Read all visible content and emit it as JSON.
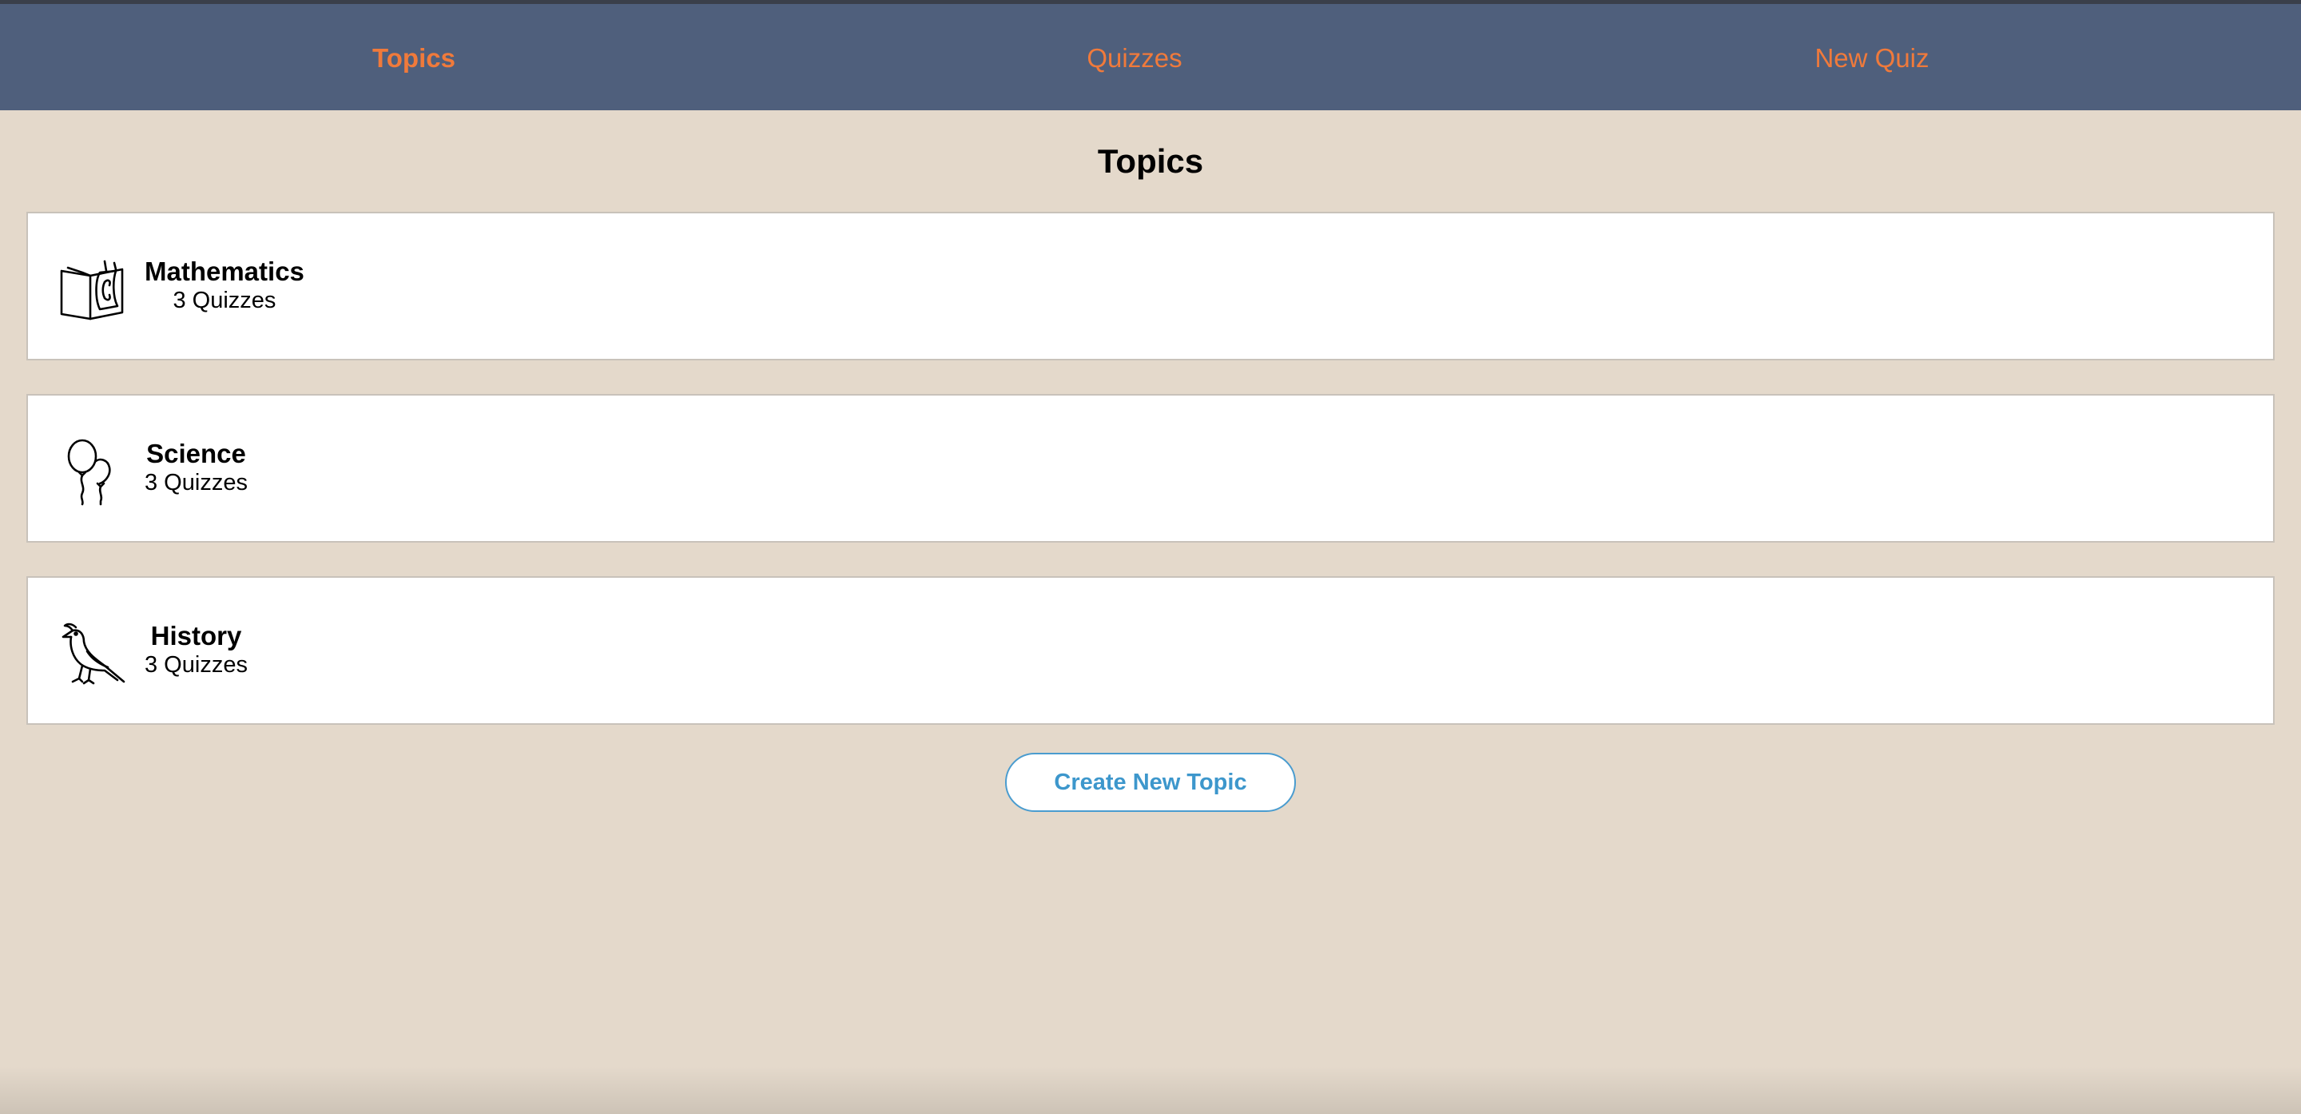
{
  "nav": {
    "items": [
      {
        "label": "Topics",
        "active": true
      },
      {
        "label": "Quizzes",
        "active": false
      },
      {
        "label": "New Quiz",
        "active": false
      }
    ]
  },
  "page": {
    "title": "Topics"
  },
  "topics": [
    {
      "name": "Mathematics",
      "count": "3 Quizzes",
      "icon": "book-icon"
    },
    {
      "name": "Science",
      "count": "3 Quizzes",
      "icon": "balloons-icon"
    },
    {
      "name": "History",
      "count": "3 Quizzes",
      "icon": "bird-icon"
    }
  ],
  "actions": {
    "create_topic_label": "Create New Topic"
  },
  "colors": {
    "nav_background": "#4f5f7c",
    "nav_link": "#f07a3b",
    "page_background": "#e4d9cb",
    "button_accent": "#3d97cc"
  }
}
